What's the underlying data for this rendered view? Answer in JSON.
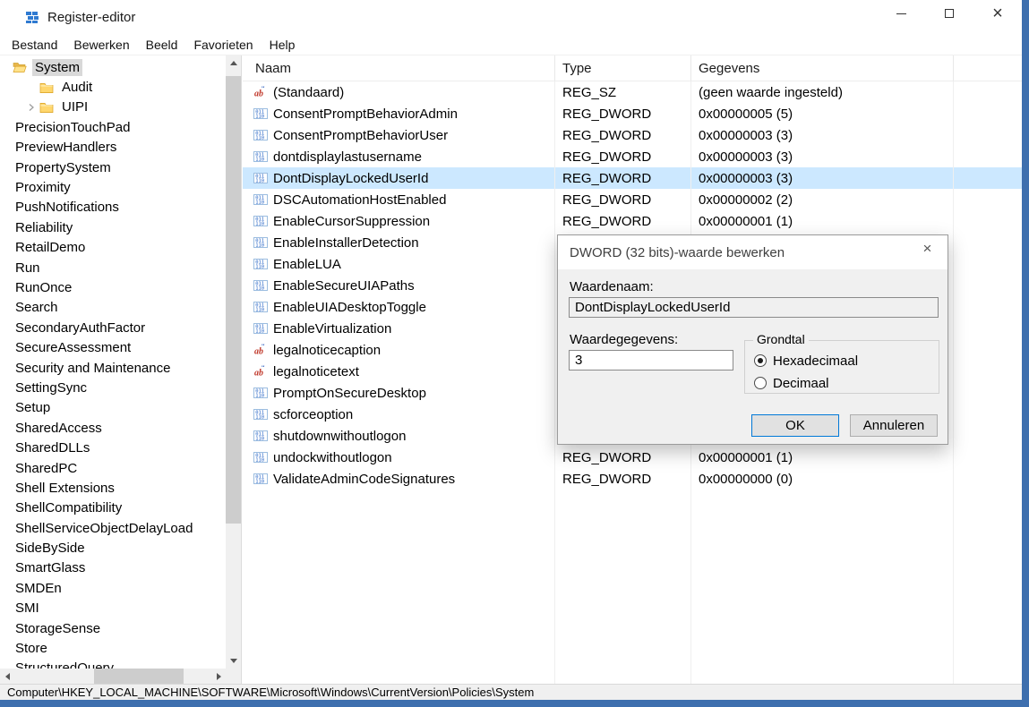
{
  "window": {
    "title": "Register-editor"
  },
  "colors": {
    "accent_border": "#3e6fae",
    "selection": "#cce8ff",
    "tree_selection": "#d9d9d9",
    "default_button_border": "#0078d7"
  },
  "menubar": {
    "items": [
      "Bestand",
      "Bewerken",
      "Beeld",
      "Favorieten",
      "Help"
    ]
  },
  "tree": {
    "items": [
      {
        "label": "System",
        "indent": 0,
        "icon": "folder-open-icon",
        "expander": false,
        "selected": true
      },
      {
        "label": "Audit",
        "indent": 1,
        "icon": "folder-icon",
        "expander": false
      },
      {
        "label": "UIPI",
        "indent": 1,
        "icon": "folder-icon",
        "expander": true
      },
      {
        "label": "PrecisionTouchPad",
        "icon": "none"
      },
      {
        "label": "PreviewHandlers",
        "icon": "none"
      },
      {
        "label": "PropertySystem",
        "icon": "none"
      },
      {
        "label": "Proximity",
        "icon": "none"
      },
      {
        "label": "PushNotifications",
        "icon": "none"
      },
      {
        "label": "Reliability",
        "icon": "none"
      },
      {
        "label": "RetailDemo",
        "icon": "none"
      },
      {
        "label": "Run",
        "icon": "none"
      },
      {
        "label": "RunOnce",
        "icon": "none"
      },
      {
        "label": "Search",
        "icon": "none"
      },
      {
        "label": "SecondaryAuthFactor",
        "icon": "none"
      },
      {
        "label": "SecureAssessment",
        "icon": "none"
      },
      {
        "label": "Security and Maintenance",
        "icon": "none"
      },
      {
        "label": "SettingSync",
        "icon": "none"
      },
      {
        "label": "Setup",
        "icon": "none"
      },
      {
        "label": "SharedAccess",
        "icon": "none"
      },
      {
        "label": "SharedDLLs",
        "icon": "none"
      },
      {
        "label": "SharedPC",
        "icon": "none"
      },
      {
        "label": "Shell Extensions",
        "icon": "none"
      },
      {
        "label": "ShellCompatibility",
        "icon": "none"
      },
      {
        "label": "ShellServiceObjectDelayLoad",
        "icon": "none"
      },
      {
        "label": "SideBySide",
        "icon": "none"
      },
      {
        "label": "SmartGlass",
        "icon": "none"
      },
      {
        "label": "SMDEn",
        "icon": "none"
      },
      {
        "label": "SMI",
        "icon": "none"
      },
      {
        "label": "StorageSense",
        "icon": "none"
      },
      {
        "label": "Store",
        "icon": "none"
      },
      {
        "label": "StructuredQuery",
        "icon": "none"
      }
    ]
  },
  "list": {
    "columns": [
      "Naam",
      "Type",
      "Gegevens"
    ],
    "rows": [
      {
        "name": "(Standaard)",
        "icon": "string-value-icon",
        "type": "REG_SZ",
        "data": "(geen waarde ingesteld)"
      },
      {
        "name": "ConsentPromptBehaviorAdmin",
        "icon": "dword-value-icon",
        "type": "REG_DWORD",
        "data": "0x00000005 (5)"
      },
      {
        "name": "ConsentPromptBehaviorUser",
        "icon": "dword-value-icon",
        "type": "REG_DWORD",
        "data": "0x00000003 (3)"
      },
      {
        "name": "dontdisplaylastusername",
        "icon": "dword-value-icon",
        "type": "REG_DWORD",
        "data": "0x00000003 (3)"
      },
      {
        "name": "DontDisplayLockedUserId",
        "icon": "dword-value-icon",
        "type": "REG_DWORD",
        "data": "0x00000003 (3)",
        "selected": true
      },
      {
        "name": "DSCAutomationHostEnabled",
        "icon": "dword-value-icon",
        "type": "REG_DWORD",
        "data": "0x00000002 (2)"
      },
      {
        "name": "EnableCursorSuppression",
        "icon": "dword-value-icon",
        "type": "REG_DWORD",
        "data": "0x00000001 (1)"
      },
      {
        "name": "EnableInstallerDetection",
        "icon": "dword-value-icon",
        "type": "",
        "data": ""
      },
      {
        "name": "EnableLUA",
        "icon": "dword-value-icon",
        "type": "",
        "data": ""
      },
      {
        "name": "EnableSecureUIAPaths",
        "icon": "dword-value-icon",
        "type": "",
        "data": ""
      },
      {
        "name": "EnableUIADesktopToggle",
        "icon": "dword-value-icon",
        "type": "",
        "data": ""
      },
      {
        "name": "EnableVirtualization",
        "icon": "dword-value-icon",
        "type": "",
        "data": ""
      },
      {
        "name": "legalnoticecaption",
        "icon": "string-value-icon",
        "type": "",
        "data": ""
      },
      {
        "name": "legalnoticetext",
        "icon": "string-value-icon",
        "type": "",
        "data": ""
      },
      {
        "name": "PromptOnSecureDesktop",
        "icon": "dword-value-icon",
        "type": "",
        "data": ""
      },
      {
        "name": "scforceoption",
        "icon": "dword-value-icon",
        "type": "",
        "data": ""
      },
      {
        "name": "shutdownwithoutlogon",
        "icon": "dword-value-icon",
        "type": "",
        "data": ""
      },
      {
        "name": "undockwithoutlogon",
        "icon": "dword-value-icon",
        "type": "REG_DWORD",
        "data": "0x00000001 (1)"
      },
      {
        "name": "ValidateAdminCodeSignatures",
        "icon": "dword-value-icon",
        "type": "REG_DWORD",
        "data": "0x00000000 (0)"
      }
    ]
  },
  "dialog": {
    "title": "DWORD (32 bits)-waarde bewerken",
    "value_name_label": "Waardenaam:",
    "value_name": "DontDisplayLockedUserId",
    "value_data_label": "Waardegegevens:",
    "value_data": "3",
    "base_label": "Grondtal",
    "hex_option": "Hexadecimaal",
    "dec_option": "Decimaal",
    "hex_selected": true,
    "ok_label": "OK",
    "cancel_label": "Annuleren"
  },
  "statusbar": {
    "path": "Computer\\HKEY_LOCAL_MACHINE\\SOFTWARE\\Microsoft\\Windows\\CurrentVersion\\Policies\\System"
  }
}
